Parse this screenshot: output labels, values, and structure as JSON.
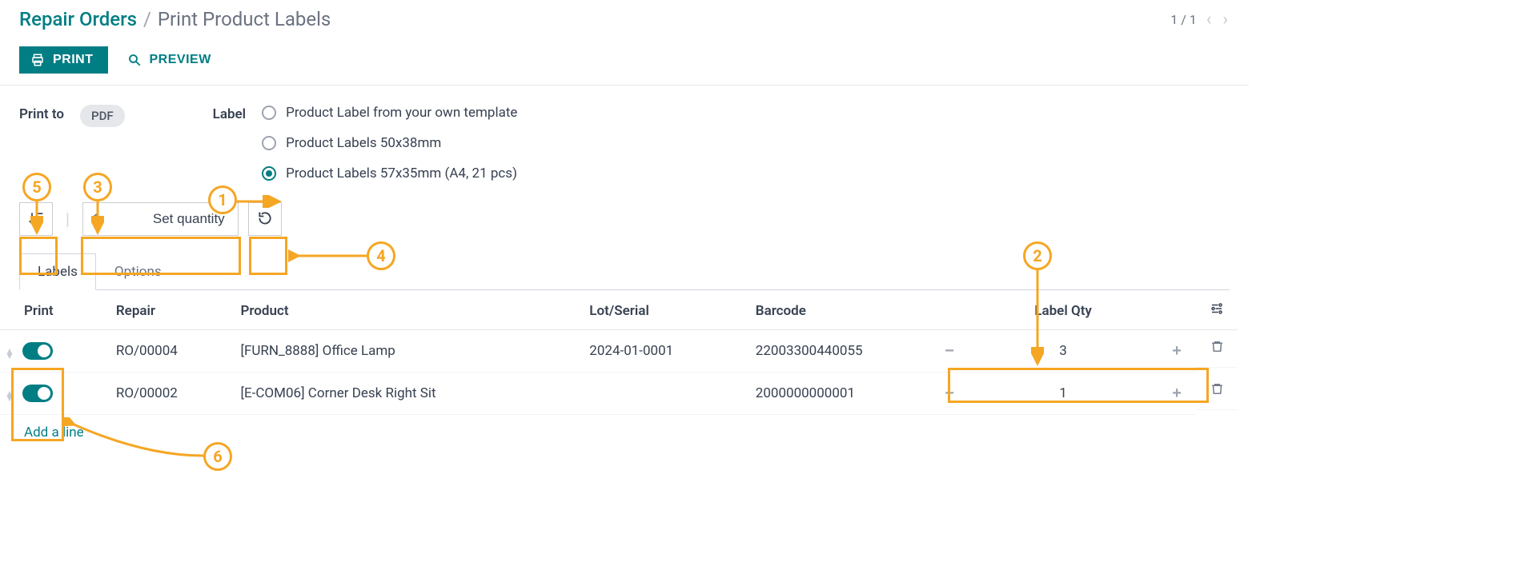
{
  "breadcrumb": {
    "root": "Repair Orders",
    "sep": "/",
    "leaf": "Print Product Labels"
  },
  "pager": {
    "text": "1 / 1"
  },
  "toolbar": {
    "print": "PRINT",
    "preview": "PREVIEW"
  },
  "form": {
    "print_to_label": "Print to",
    "print_to_value": "PDF",
    "label_label": "Label",
    "radio_options": [
      {
        "label": "Product Label from your own template",
        "selected": false
      },
      {
        "label": "Product Labels 50x38mm",
        "selected": false
      },
      {
        "label": "Product Labels 57x35mm (A4, 21 pcs)",
        "selected": true
      }
    ]
  },
  "qty_controls": {
    "value": "1",
    "set_label": "Set quantity"
  },
  "tabs": {
    "labels": "Labels",
    "options": "Options"
  },
  "table": {
    "headers": {
      "print": "Print",
      "repair": "Repair",
      "product": "Product",
      "lot": "Lot/Serial",
      "barcode": "Barcode",
      "qty": "Label Qty"
    },
    "rows": [
      {
        "repair": "RO/00004",
        "product": "[FURN_8888] Office Lamp",
        "lot": "2024-01-0001",
        "barcode": "22003300440055",
        "qty": "3"
      },
      {
        "repair": "RO/00002",
        "product": "[E-COM06] Corner Desk Right Sit",
        "lot": "",
        "barcode": "2000000000001",
        "qty": "1"
      }
    ],
    "add_line": "Add a line"
  },
  "annotations": {
    "n1": "1",
    "n2": "2",
    "n3": "3",
    "n4": "4",
    "n5": "5",
    "n6": "6"
  }
}
